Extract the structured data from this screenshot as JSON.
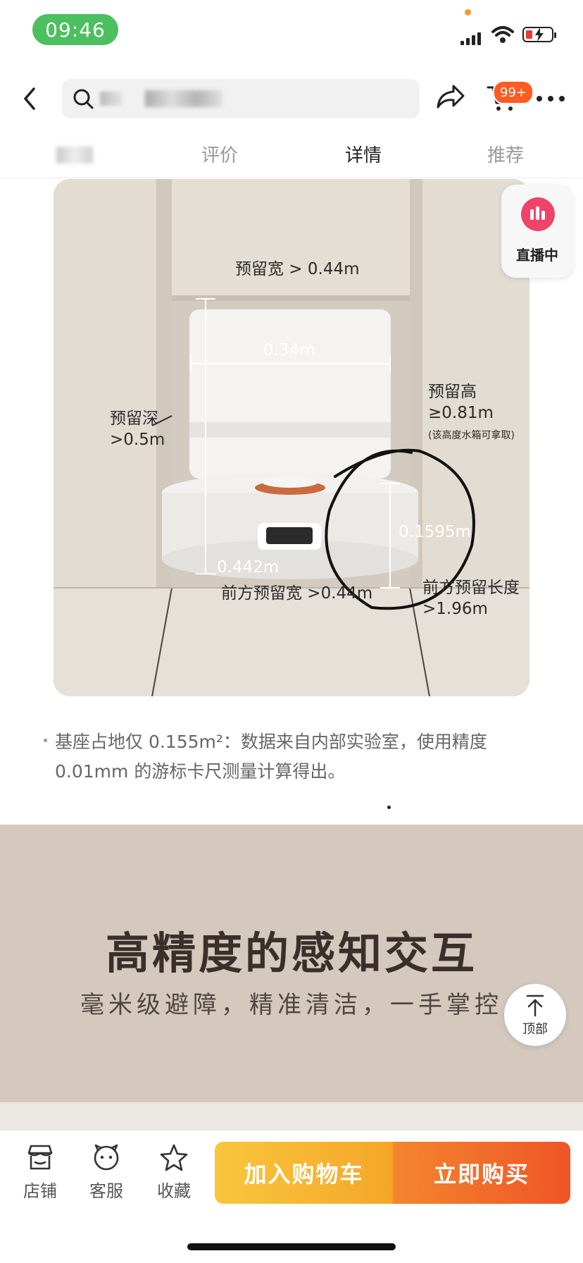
{
  "status": {
    "time": "09:46"
  },
  "header": {
    "cart_badge": "99+"
  },
  "tabs": [
    {
      "label": "评价"
    },
    {
      "label": "详情"
    },
    {
      "label": "推荐"
    }
  ],
  "live": {
    "label": "直播中"
  },
  "product_image": {
    "width_label": "预留宽 > 0.44m",
    "dock_width": "0.34m",
    "height_label": "预留高",
    "height_value": "≥0.81m",
    "height_note": "(该高度水箱可拿取)",
    "depth_label": "预留深",
    "depth_value": ">0.5m",
    "robot_height": "0.1595m",
    "base_depth": "0.442m",
    "front_width": "前方预留宽 >0.44m",
    "front_length_label": "前方预留长度",
    "front_length_value": ">1.96m"
  },
  "footnote": "基座占地仅 0.155m²：数据来自内部实验室，使用精度 0.01mm 的游标卡尺测量计算得出。",
  "section": {
    "title": "高精度的感知交互",
    "subtitle": "毫米级避障，精准清洁，一手掌控"
  },
  "to_top": {
    "label": "顶部"
  },
  "bottom": {
    "store": "店铺",
    "service": "客服",
    "favorite": "收藏",
    "add_to_cart": "加入购物车",
    "buy_now": "立即购买"
  }
}
